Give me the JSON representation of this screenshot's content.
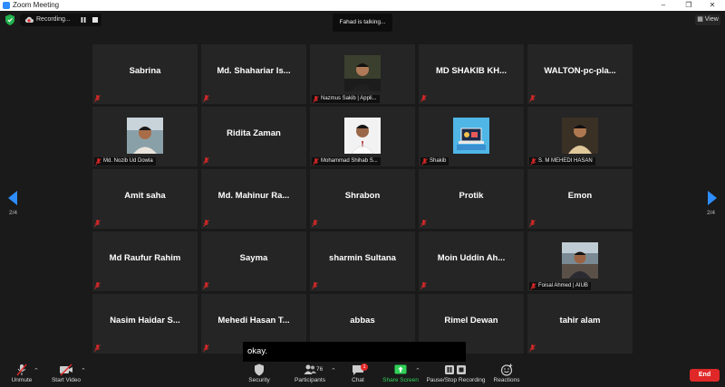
{
  "window": {
    "title": "Zoom Meeting"
  },
  "recording": {
    "label": "Recording..."
  },
  "talking": "Fahad is talking...",
  "view_button": "View",
  "nav": {
    "left_page": "2/4",
    "right_page": "2/4"
  },
  "tiles": [
    {
      "name": "Sabrina"
    },
    {
      "name": "Md. Shahariar Is..."
    },
    {
      "label": "Nazmus Sakib | Appli..."
    },
    {
      "name": "MD SHAKIB KH..."
    },
    {
      "name": "WALTON-pc-pla..."
    },
    {
      "label": "Md. Nozib Ud Dowla"
    },
    {
      "name": "Ridita Zaman"
    },
    {
      "label": "Mohammad Shihab S..."
    },
    {
      "label": "Shakib"
    },
    {
      "label": "S. M MEHEDI HASAN"
    },
    {
      "name": "Amit saha"
    },
    {
      "name": "Md. Mahinur Ra..."
    },
    {
      "name": "Shrabon"
    },
    {
      "name": "Protik"
    },
    {
      "name": "Emon"
    },
    {
      "name": "Md Raufur Rahim"
    },
    {
      "name": "Sayma"
    },
    {
      "name": "sharmin Sultana"
    },
    {
      "name": "Moin Uddin Ah..."
    },
    {
      "label": "Foisal Ahmed | AIUB"
    },
    {
      "name": "Nasim Haidar S..."
    },
    {
      "name": "Mehedi Hasan T..."
    },
    {
      "name": "abbas"
    },
    {
      "name": "Rimel Dewan"
    },
    {
      "name": "tahir alam"
    }
  ],
  "caption": "okay.",
  "toolbar": {
    "unmute": "Unmute",
    "start_video": "Start Video",
    "security": "Security",
    "participants": "Participants",
    "participants_count": "76",
    "chat": "Chat",
    "chat_badge": "1",
    "share_screen": "Share Screen",
    "pause_stop_recording": "Pause/Stop Recording",
    "reactions": "Reactions",
    "end": "End"
  },
  "colors": {
    "accent": "#2d8cff",
    "share_green": "#30d158",
    "end_red": "#e02828",
    "muted_red": "#e02828"
  }
}
